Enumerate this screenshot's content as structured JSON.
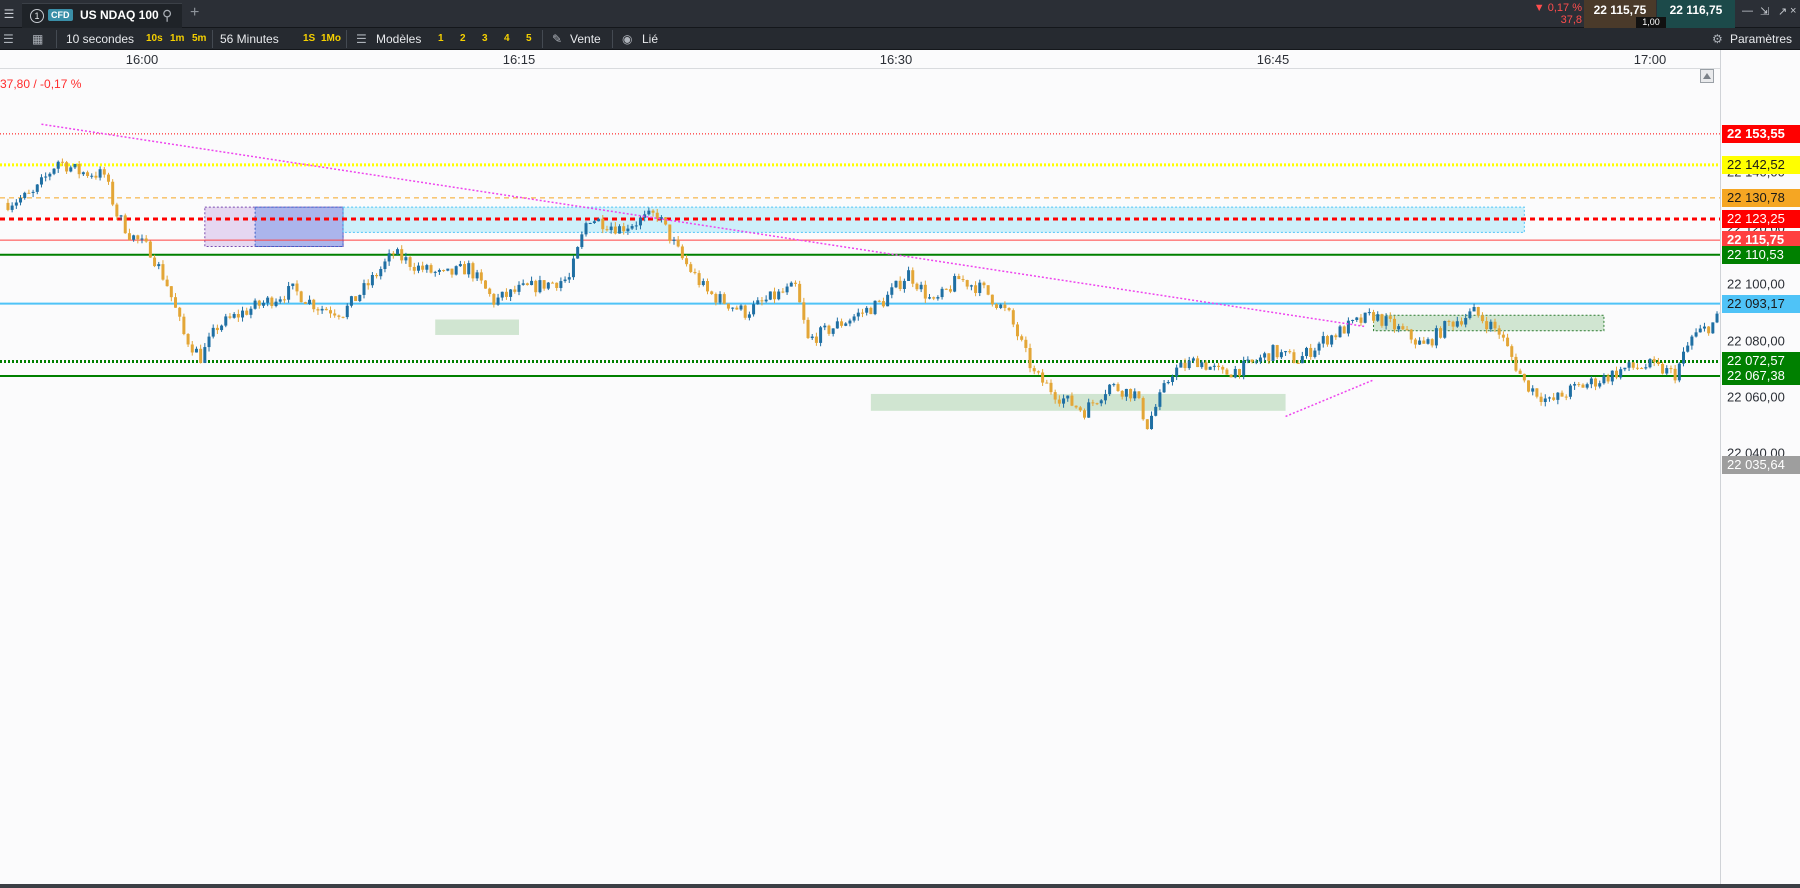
{
  "topbar": {
    "menu_icon": "menu-icon",
    "tab_number": "1",
    "instrument_type": "CFD",
    "instrument_name": "US NDAQ 100",
    "search_icon": "search-icon",
    "add_tab_icon": "plus-icon",
    "change_pct": "▼ 0,17 %",
    "change_abs": "37,8",
    "bid_price": "22 115,75",
    "spread": "1,00",
    "ask_price": "22 116,75"
  },
  "toolbar": {
    "interval_label": "10 secondes",
    "interval_shortcuts": [
      "10s",
      "1m",
      "5m"
    ],
    "period_label": "56 Minutes",
    "period_shortcuts": [
      "1S",
      "1Mo"
    ],
    "templates_label": "Modèles",
    "template_slots": [
      "1",
      "2",
      "3",
      "4",
      "5"
    ],
    "trade_label": "Vente",
    "linked_label": "Lié",
    "settings_label": "Paramètres"
  },
  "colors": {
    "up": "#1f6fa3",
    "down": "#e3a637",
    "red": "#ff0000",
    "yellow": "#ffff00",
    "orange": "#f5a623",
    "dark_red": "#c00000",
    "green": "#008000",
    "blue": "#4fc3f7"
  },
  "chart_data": {
    "type": "candlestick",
    "change_info": "37,80 / -0,17 %",
    "x_ticks": [
      "16:00",
      "16:15",
      "16:30",
      "16:45",
      "17:00"
    ],
    "y_ticks": [
      "22 140,00",
      "22 120,00",
      "22 100,00",
      "22 080,00",
      "22 060,00",
      "22 040,00"
    ],
    "ylim": [
      22034,
      22157
    ],
    "x_range": [
      "15:54:40",
      "17:03:10"
    ],
    "close_path": [
      [
        "15:54:40",
        22129
      ],
      [
        "15:55:40",
        22132
      ],
      [
        "15:56:40",
        22144
      ],
      [
        "15:57:30",
        22140
      ],
      [
        "15:58:30",
        22139
      ],
      [
        "15:59:00",
        22125
      ],
      [
        "15:59:30",
        22118
      ],
      [
        "16:00:20",
        22112
      ],
      [
        "16:01:00",
        22100
      ],
      [
        "16:01:40",
        22082
      ],
      [
        "16:02:20",
        22074
      ],
      [
        "16:03:00",
        22085
      ],
      [
        "16:04:00",
        22090
      ],
      [
        "16:05:00",
        22094
      ],
      [
        "16:06:00",
        22098
      ],
      [
        "16:07:00",
        22092
      ],
      [
        "16:08:00",
        22090
      ],
      [
        "16:09:00",
        22100
      ],
      [
        "16:10:00",
        22111
      ],
      [
        "16:11:00",
        22106
      ],
      [
        "16:12:00",
        22103
      ],
      [
        "16:13:00",
        22106
      ],
      [
        "16:14:00",
        22094
      ],
      [
        "16:15:00",
        22098
      ],
      [
        "16:16:00",
        22100
      ],
      [
        "16:17:00",
        22102
      ],
      [
        "16:17:45",
        22124
      ],
      [
        "16:19:00",
        22120
      ],
      [
        "16:20:30",
        22125
      ],
      [
        "16:21:30",
        22109
      ],
      [
        "16:22:30",
        22097
      ],
      [
        "16:24:00",
        22090
      ],
      [
        "16:25:00",
        22095
      ],
      [
        "16:26:00",
        22099
      ],
      [
        "16:26:30",
        22080
      ],
      [
        "16:28:00",
        22087
      ],
      [
        "16:29:30",
        22094
      ],
      [
        "16:30:30",
        22104
      ],
      [
        "16:31:30",
        22093
      ],
      [
        "16:32:30",
        22102
      ],
      [
        "16:33:30",
        22098
      ],
      [
        "16:34:30",
        22089
      ],
      [
        "16:35:30",
        22068
      ],
      [
        "16:36:30",
        22060
      ],
      [
        "16:37:30",
        22055
      ],
      [
        "16:38:30",
        22064
      ],
      [
        "16:39:30",
        22061
      ],
      [
        "16:40:00",
        22050
      ],
      [
        "16:41:00",
        22069
      ],
      [
        "16:42:00",
        22073
      ],
      [
        "16:43:00",
        22068
      ],
      [
        "16:44:00",
        22071
      ],
      [
        "16:45:00",
        22076
      ],
      [
        "16:46:00",
        22073
      ],
      [
        "16:47:00",
        22080
      ],
      [
        "16:48:00",
        22085
      ],
      [
        "16:49:00",
        22089
      ],
      [
        "16:50:00",
        22084
      ],
      [
        "16:51:00",
        22078
      ],
      [
        "16:52:00",
        22086
      ],
      [
        "16:53:00",
        22090
      ],
      [
        "16:54:00",
        22083
      ],
      [
        "16:55:00",
        22065
      ],
      [
        "16:56:00",
        22058
      ],
      [
        "16:57:00",
        22063
      ],
      [
        "16:58:00",
        22066
      ],
      [
        "16:59:00",
        22070
      ],
      [
        "17:00:00",
        22071
      ],
      [
        "17:01:00",
        22068
      ],
      [
        "17:01:40",
        22081
      ],
      [
        "17:02:30",
        22086
      ],
      [
        "17:03:10",
        22093
      ]
    ],
    "lines": [
      {
        "label": "22 153,55",
        "value": 22153.55,
        "color": "#ff0000",
        "style": "dotted-thin"
      },
      {
        "label": "22 142,52",
        "value": 22142.52,
        "color": "#ffff00",
        "style": "dotted-thick"
      },
      {
        "label": "22 130,78",
        "value": 22130.78,
        "color": "#f5a623",
        "style": "dashed"
      },
      {
        "label": "22 123,25",
        "value": 22123.25,
        "color": "#ff0000",
        "style": "dashed-thick"
      },
      {
        "label": "22 115,75",
        "value": 22115.75,
        "color": "#ff4040",
        "style": "solid-thin"
      },
      {
        "label": "22 110,53",
        "value": 22110.53,
        "color": "#008000",
        "style": "solid"
      },
      {
        "label": "22 093,17",
        "value": 22093.17,
        "color": "#4fc3f7",
        "style": "solid"
      },
      {
        "label": "22 072,57",
        "value": 22072.57,
        "color": "#008000",
        "style": "dotted-thick"
      },
      {
        "label": "22 067,38",
        "value": 22067.38,
        "color": "#008000",
        "style": "solid"
      },
      {
        "label": "22 035,64",
        "value": 22035.64,
        "color": "#9e9e9e",
        "style": "none"
      }
    ],
    "zones": [
      {
        "t1": "16:02:30",
        "t2": "16:08:00",
        "y1": 22127.5,
        "y2": 22113.5,
        "color": "rgba(190,150,220,0.35)",
        "border": "#7a4bb0"
      },
      {
        "t1": "16:04:30",
        "t2": "16:08:00",
        "y1": 22127.5,
        "y2": 22113.5,
        "color": "rgba(100,140,230,0.45)",
        "border": "#3b5fc9"
      },
      {
        "t1": "16:08:00",
        "t2": "16:55:00",
        "y1": 22127.5,
        "y2": 22118.5,
        "color": "rgba(120,220,245,0.35)",
        "border": "#4fc3f7"
      },
      {
        "t1": "16:11:40",
        "t2": "16:15:00",
        "y1": 22087.5,
        "y2": 22082,
        "color": "rgba(130,190,130,0.35)",
        "border": "none"
      },
      {
        "t1": "16:29:00",
        "t2": "16:45:30",
        "y1": 22061,
        "y2": 22055,
        "color": "rgba(130,190,130,0.35)",
        "border": "none"
      },
      {
        "t1": "16:49:00",
        "t2": "16:58:10",
        "y1": 22089,
        "y2": 22083.5,
        "color": "rgba(130,190,130,0.35)",
        "border": "#2e7d32"
      }
    ],
    "trendlines": [
      {
        "t1": "15:56:00",
        "y1": 22157,
        "t2": "16:48:40",
        "y2": 22085,
        "color": "#ee44ee"
      },
      {
        "t1": "16:45:30",
        "y1": 22053,
        "t2": "16:49:00",
        "y2": 22066,
        "color": "#ee44ee"
      }
    ]
  }
}
